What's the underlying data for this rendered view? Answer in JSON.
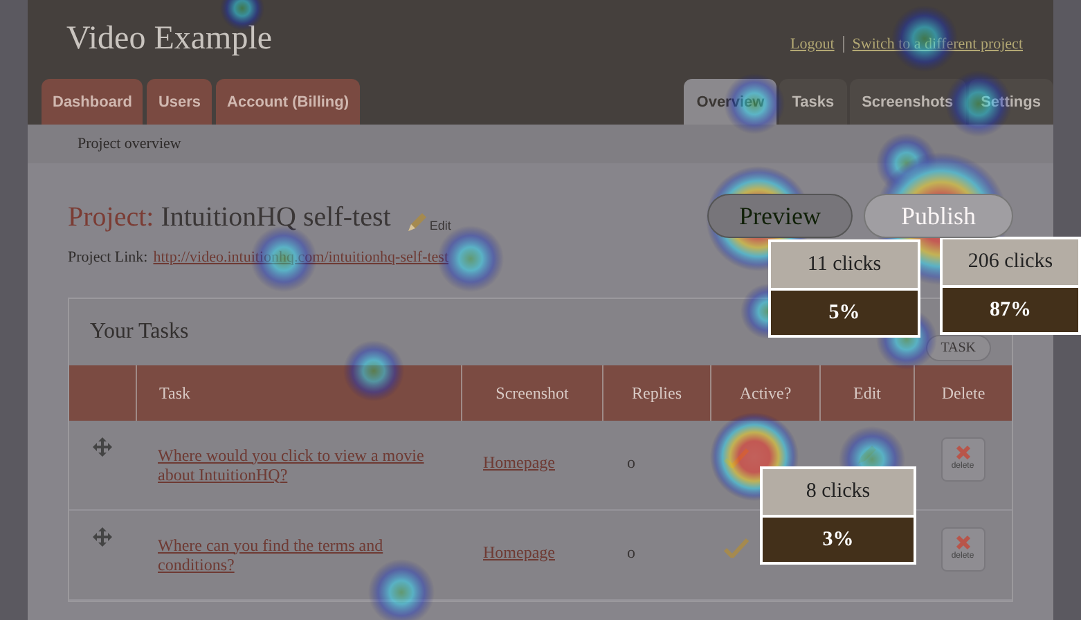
{
  "header": {
    "title": "Video Example",
    "links": [
      "Logout",
      "Switch to a different project"
    ]
  },
  "left_tabs": [
    {
      "label": "Dashboard"
    },
    {
      "label": "Users"
    },
    {
      "label": "Account (Billing)"
    }
  ],
  "right_tabs": [
    {
      "label": "Overview",
      "selected": true
    },
    {
      "label": "Tasks",
      "selected": false
    },
    {
      "label": "Screenshots",
      "selected": false
    },
    {
      "label": "Settings",
      "selected": false
    }
  ],
  "breadcrumb": "Project overview",
  "project": {
    "prefix": "Project:",
    "name": "IntuitionHQ self-test",
    "edit": "Edit",
    "link_label": "Project Link:",
    "link": "http://video.intuitionhq.com/intuitionhq-self-test"
  },
  "buttons": [
    "Preview",
    "Publish"
  ],
  "tasks_panel": {
    "title": "Your Tasks",
    "add_button": "TASK",
    "columns": [
      "Task",
      "Screenshot",
      "Replies",
      "Active?",
      "Edit",
      "Delete"
    ],
    "rows": [
      {
        "task": "Where would you click to view a movie about IntuitionHQ?",
        "screenshot": "Homepage",
        "replies": "o",
        "active": true,
        "delete": "delete"
      },
      {
        "task": "Where can you find the terms and conditions?",
        "screenshot": "Homepage",
        "replies": "o",
        "active": true,
        "delete": "delete"
      }
    ]
  },
  "callouts": [
    {
      "clicks": "11 clicks",
      "percent": "5%"
    },
    {
      "clicks": "206 clicks",
      "percent": "87%"
    },
    {
      "clicks": "8 clicks",
      "percent": "3%"
    }
  ]
}
